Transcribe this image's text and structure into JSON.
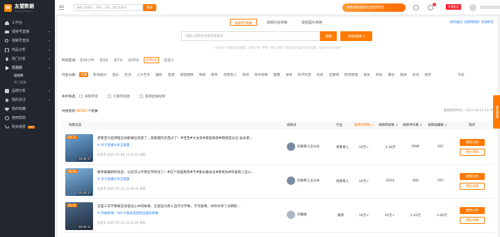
{
  "brand": {
    "name": "友望数据",
    "sub": "www.youwang.cn",
    "logo": "W"
  },
  "sidebar": {
    "items": [
      {
        "label": "工作台",
        "icon": "home-icon"
      },
      {
        "label": "视频号直播",
        "icon": "live-icon",
        "arrow": "▾"
      },
      {
        "label": "视频号查找",
        "icon": "search-icon",
        "arrow": "▾"
      },
      {
        "label": "商品分析",
        "icon": "goods-icon",
        "arrow": "▾"
      },
      {
        "label": "热门分析",
        "icon": "fire-icon",
        "arrow": "▾"
      },
      {
        "label": "短视频",
        "icon": "video-icon",
        "arrow": "▴"
      }
    ],
    "sub_items": [
      {
        "label": "短视频"
      },
      {
        "label": "热门视频"
      }
    ],
    "bottom_items": [
      {
        "label": "品牌分析",
        "icon": "brand-icon",
        "arrow": "▾"
      },
      {
        "label": "我的关注",
        "icon": "star-icon",
        "arrow": "▾"
      },
      {
        "label": "我的收藏",
        "icon": "heart-icon"
      },
      {
        "label": "使用帮助",
        "icon": "help-icon"
      },
      {
        "label": "购买续费",
        "icon": "cart-icon",
        "badge": "VIP"
      }
    ]
  },
  "topbar": {
    "search_placeholder": "请输入视频号、视频、品牌、商品关键词",
    "search_button": "搜索",
    "promo": "免费领取视频号运营资料包",
    "notify_count": "1",
    "vip_label": "开通会员"
  },
  "main": {
    "tabs": [
      {
        "label": "视频号搜索",
        "active": true
      },
      {
        "label": "视频内容搜索",
        "active": false
      },
      {
        "label": "视频图片搜索",
        "active": false
      }
    ],
    "help_link": "如何通过【视频搜索】快速找号",
    "search_placeholder": "请输入视频号名称或关键词",
    "search_button": "搜索",
    "adv_button": "高级搜索 ▾",
    "hint": "*支持多个关键词同时搜索，空格分隔（例如：教育 美食）同时匹配标题内容与话题；仅支持中文关键词"
  },
  "filters": {
    "time": {
      "label": "时间区间:",
      "options": [
        "近24小时",
        "近3天",
        "近7天",
        "近30天",
        "近90天",
        "自定义"
      ],
      "active_index": 4
    },
    "industry": {
      "label": "行业分类:",
      "options": [
        "全部",
        "影视娱乐",
        "音乐",
        "生活",
        "人文艺术",
        "摄影",
        "旅游",
        "萌宠萌物",
        "情感",
        "教育",
        "母婴育儿",
        "财经",
        "政务政要",
        "健康",
        "体育",
        "科学科普",
        "科技",
        "互联网",
        "职场管理",
        "美食",
        "时尚",
        "美妆",
        "媒体",
        "资讯",
        "搞笑"
      ],
      "extra": "汽车",
      "active_index": 0
    },
    "conditions": {
      "label": "条件筛选:",
      "options": [
        "排除带货",
        "只看带话题",
        "排除挂链视频"
      ]
    }
  },
  "summary": {
    "prefix": "共搜索到",
    "count": "88960",
    "suffix": "个结果"
  },
  "updated": "数据更新时间：2021-08-24 15:30",
  "table": {
    "headers": [
      "视频信息",
      "视频号",
      "行业",
      "视频点赞数 ↓",
      "视频转发数 ↓",
      "视频评论数 ↓",
      "视频收藏数 ↓",
      "操作"
    ],
    "rows": [
      {
        "score": "58.31",
        "duration": "00:00:37",
        "title": "育婴宝对自持理念创新做出改变了，高质量的东西过了！#宝宝#大女孩#家庭情感#萌娃成长记 @米诺...",
        "tag": "# 亲子直播分享正能量",
        "meta": "北京市   2021-07-08 12:25:23 发布",
        "blogger": "欢辰育儿怎么办",
        "industry": "母婴育儿",
        "likes": "10万+",
        "shares": "2.44万",
        "comments": "7699",
        "favorites": "597"
      },
      {
        "score": "58.06",
        "duration": "00:00:37",
        "title": "教育部最新的消息，以后可以不用在学校住了！#这个就是教育#不#家长最关注#教育局#欢辰育儿怎么...",
        "tag": "# 亲子直播分享正能量",
        "meta": "北京市   2021-07-10 11:46:09 发布",
        "blogger": "欢辰育儿怎么办",
        "industry": "母婴育儿",
        "likes": "10万+",
        "shares": "4163",
        "comments": "900",
        "favorites": "597"
      },
      {
        "score": "39.95",
        "duration": "00:00:31",
        "title": "这是三双不要被这话说出心中的故事，王思远为育人自行讨学事，不可能啊，你到才有了光明的...",
        "tag": "# 阿福星球：为什么我总是回到这里的感慨",
        "meta": "北京市   2021-07-22 15:52:26 发布",
        "blogger": "刘耀德",
        "industry": "教育",
        "likes": "10万+",
        "shares": "10万+",
        "comments": "1.03万",
        "favorites": "3.40万"
      }
    ],
    "op_primary": "视频分析",
    "op_secondary": "博主详情"
  },
  "side_float": "联系客服"
}
